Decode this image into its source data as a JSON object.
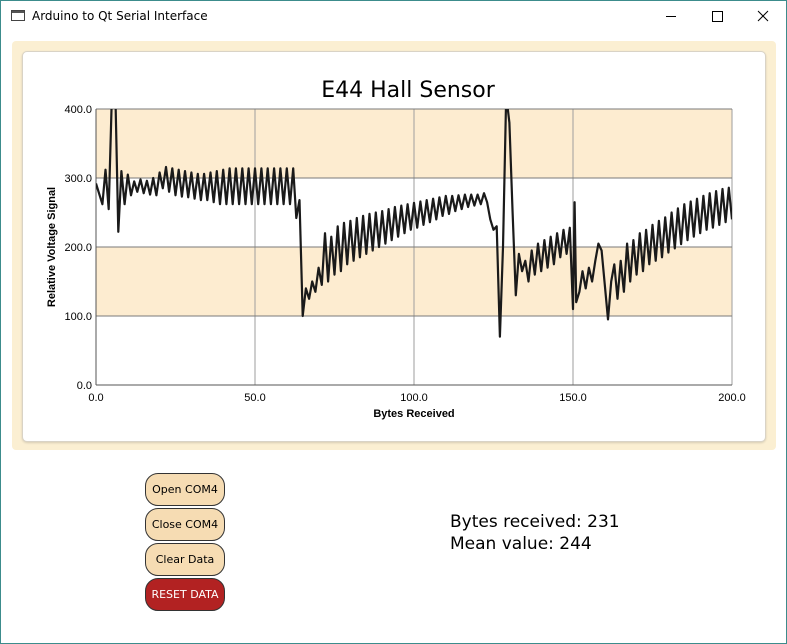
{
  "window": {
    "title": "Arduino to Qt Serial Interface",
    "controls": [
      "minimize",
      "maximize",
      "close"
    ]
  },
  "chart_data": {
    "type": "line",
    "title": "E44 Hall Sensor",
    "xlabel": "Bytes Received",
    "ylabel": "Relative Voltage Signal",
    "xlim": [
      0,
      200
    ],
    "ylim": [
      0,
      400
    ],
    "xticks": [
      "0.0",
      "50.0",
      "100.0",
      "150.0",
      "200.0"
    ],
    "yticks": [
      "0.0",
      "100.0",
      "200.0",
      "300.0",
      "400.0"
    ],
    "grid": true,
    "band_color": "#fdecd0",
    "line_color": "#1a1a1a",
    "series": [
      {
        "points": [
          [
            0,
            292
          ],
          [
            2,
            262
          ],
          [
            3,
            312
          ],
          [
            4,
            255
          ],
          [
            5,
            420
          ],
          [
            6,
            440
          ],
          [
            7,
            222
          ],
          [
            8,
            310
          ],
          [
            9,
            262
          ],
          [
            10,
            305
          ],
          [
            11,
            275
          ],
          [
            12,
            295
          ],
          [
            13,
            280
          ],
          [
            14,
            298
          ],
          [
            15,
            278
          ],
          [
            16,
            296
          ],
          [
            17,
            276
          ],
          [
            18,
            300
          ],
          [
            19,
            275
          ],
          [
            20,
            308
          ],
          [
            21,
            285
          ],
          [
            22,
            316
          ],
          [
            23,
            280
          ],
          [
            24,
            314
          ],
          [
            25,
            275
          ],
          [
            26,
            312
          ],
          [
            27,
            273
          ],
          [
            28,
            310
          ],
          [
            29,
            272
          ],
          [
            30,
            308
          ],
          [
            31,
            270
          ],
          [
            32,
            306
          ],
          [
            33,
            268
          ],
          [
            34,
            306
          ],
          [
            35,
            268
          ],
          [
            36,
            308
          ],
          [
            37,
            265
          ],
          [
            38,
            310
          ],
          [
            39,
            262
          ],
          [
            40,
            312
          ],
          [
            41,
            262
          ],
          [
            42,
            314
          ],
          [
            43,
            262
          ],
          [
            44,
            314
          ],
          [
            45,
            262
          ],
          [
            46,
            314
          ],
          [
            47,
            262
          ],
          [
            48,
            314
          ],
          [
            49,
            262
          ],
          [
            50,
            314
          ],
          [
            51,
            262
          ],
          [
            52,
            314
          ],
          [
            53,
            262
          ],
          [
            54,
            314
          ],
          [
            55,
            262
          ],
          [
            56,
            314
          ],
          [
            57,
            262
          ],
          [
            58,
            314
          ],
          [
            59,
            262
          ],
          [
            60,
            314
          ],
          [
            61,
            262
          ],
          [
            62,
            314
          ],
          [
            63,
            242
          ],
          [
            64,
            268
          ],
          [
            65,
            100
          ],
          [
            66,
            140
          ],
          [
            67,
            125
          ],
          [
            68,
            150
          ],
          [
            69,
            135
          ],
          [
            70,
            170
          ],
          [
            71,
            145
          ],
          [
            72,
            220
          ],
          [
            73,
            150
          ],
          [
            74,
            215
          ],
          [
            75,
            160
          ],
          [
            76,
            230
          ],
          [
            77,
            165
          ],
          [
            78,
            235
          ],
          [
            79,
            175
          ],
          [
            80,
            238
          ],
          [
            81,
            180
          ],
          [
            82,
            242
          ],
          [
            83,
            185
          ],
          [
            84,
            245
          ],
          [
            85,
            190
          ],
          [
            86,
            248
          ],
          [
            87,
            195
          ],
          [
            88,
            250
          ],
          [
            89,
            200
          ],
          [
            90,
            252
          ],
          [
            91,
            205
          ],
          [
            92,
            255
          ],
          [
            93,
            210
          ],
          [
            94,
            258
          ],
          [
            95,
            215
          ],
          [
            96,
            260
          ],
          [
            97,
            220
          ],
          [
            98,
            262
          ],
          [
            99,
            225
          ],
          [
            100,
            264
          ],
          [
            101,
            228
          ],
          [
            102,
            266
          ],
          [
            103,
            232
          ],
          [
            104,
            268
          ],
          [
            105,
            236
          ],
          [
            106,
            270
          ],
          [
            107,
            240
          ],
          [
            108,
            272
          ],
          [
            109,
            245
          ],
          [
            110,
            274
          ],
          [
            111,
            248
          ],
          [
            112,
            274
          ],
          [
            113,
            252
          ],
          [
            114,
            275
          ],
          [
            115,
            255
          ],
          [
            116,
            276
          ],
          [
            117,
            258
          ],
          [
            118,
            276
          ],
          [
            119,
            260
          ],
          [
            120,
            276
          ],
          [
            121,
            262
          ],
          [
            122,
            278
          ],
          [
            123,
            265
          ],
          [
            124,
            240
          ],
          [
            125,
            225
          ],
          [
            126,
            230
          ],
          [
            127,
            70
          ],
          [
            128,
            200
          ],
          [
            129,
            420
          ],
          [
            130,
            380
          ],
          [
            131,
            250
          ],
          [
            132,
            130
          ],
          [
            133,
            190
          ],
          [
            134,
            165
          ],
          [
            135,
            180
          ],
          [
            136,
            150
          ],
          [
            137,
            195
          ],
          [
            138,
            160
          ],
          [
            139,
            205
          ],
          [
            140,
            165
          ],
          [
            141,
            210
          ],
          [
            142,
            170
          ],
          [
            143,
            215
          ],
          [
            144,
            175
          ],
          [
            145,
            220
          ],
          [
            146,
            185
          ],
          [
            147,
            225
          ],
          [
            148,
            190
          ],
          [
            149,
            228
          ],
          [
            150,
            110
          ],
          [
            150.5,
            265
          ],
          [
            151,
            120
          ],
          [
            152,
            135
          ],
          [
            153,
            165
          ],
          [
            154,
            140
          ],
          [
            155,
            170
          ],
          [
            156,
            150
          ],
          [
            157,
            180
          ],
          [
            158,
            205
          ],
          [
            159,
            195
          ],
          [
            160,
            145
          ],
          [
            161,
            95
          ],
          [
            162,
            150
          ],
          [
            163,
            175
          ],
          [
            164,
            125
          ],
          [
            165,
            180
          ],
          [
            166,
            135
          ],
          [
            167,
            205
          ],
          [
            168,
            150
          ],
          [
            169,
            210
          ],
          [
            170,
            160
          ],
          [
            171,
            220
          ],
          [
            172,
            165
          ],
          [
            173,
            225
          ],
          [
            174,
            175
          ],
          [
            175,
            232
          ],
          [
            176,
            180
          ],
          [
            177,
            238
          ],
          [
            178,
            185
          ],
          [
            179,
            243
          ],
          [
            180,
            192
          ],
          [
            181,
            250
          ],
          [
            182,
            198
          ],
          [
            183,
            256
          ],
          [
            184,
            204
          ],
          [
            185,
            262
          ],
          [
            186,
            210
          ],
          [
            187,
            266
          ],
          [
            188,
            215
          ],
          [
            189,
            270
          ],
          [
            190,
            220
          ],
          [
            191,
            274
          ],
          [
            192,
            225
          ],
          [
            193,
            278
          ],
          [
            194,
            228
          ],
          [
            195,
            281
          ],
          [
            196,
            232
          ],
          [
            197,
            284
          ],
          [
            198,
            236
          ],
          [
            199,
            286
          ],
          [
            200,
            240
          ]
        ]
      }
    ]
  },
  "controls": {
    "open_label": "Open COM4",
    "close_label": "Close COM4",
    "clear_label": "Clear Data",
    "reset_label": "RESET DATA",
    "reset_color": "#b22222",
    "button_color": "#f6dcb3"
  },
  "stats": {
    "bytes_text": "Bytes received: 231",
    "mean_text": "Mean value: 244"
  }
}
